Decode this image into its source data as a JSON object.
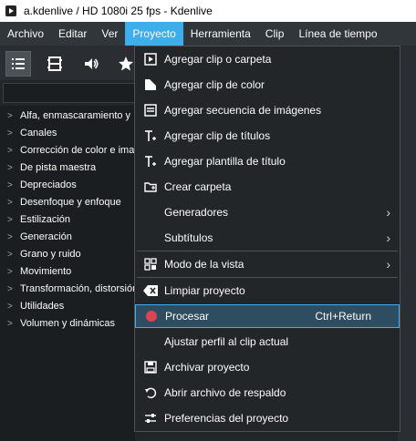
{
  "window": {
    "title": "a.kdenlive / HD 1080i 25 fps - Kdenlive"
  },
  "menubar": [
    {
      "label": "Archivo"
    },
    {
      "label": "Editar"
    },
    {
      "label": "Ver"
    },
    {
      "label": "Proyecto"
    },
    {
      "label": "Herramienta"
    },
    {
      "label": "Clip"
    },
    {
      "label": "Línea de tiempo"
    }
  ],
  "effects_tree": [
    "Alfa, enmascaramiento y",
    "Canales",
    "Corrección de color e imag",
    "De pista maestra",
    "Depreciados",
    "Desenfoque y enfoque",
    "Estilización",
    "Generación",
    "Grano y ruido",
    "Movimiento",
    "Transformación, distorsión",
    "Utilidades",
    "Volumen y dinámicas"
  ],
  "project_menu": {
    "items": [
      {
        "label": "Agregar clip o carpeta",
        "icon": "add-clip-icon"
      },
      {
        "label": "Agregar clip de color",
        "icon": "color-clip-icon"
      },
      {
        "label": "Agregar secuencia de imágenes",
        "icon": "image-sequence-icon"
      },
      {
        "label": "Agregar clip de títulos",
        "icon": "title-clip-icon"
      },
      {
        "label": "Agregar plantilla de título",
        "icon": "title-template-icon"
      },
      {
        "label": "Crear carpeta",
        "icon": "folder-icon"
      },
      {
        "label": "Generadores",
        "icon": ""
      },
      {
        "label": "Subtítulos",
        "icon": ""
      },
      {
        "label": "Modo de la vista",
        "icon": "view-mode-icon"
      },
      {
        "label": "Limpiar proyecto",
        "icon": "clear-icon"
      },
      {
        "label": "Procesar",
        "icon": "render-icon",
        "shortcut": "Ctrl+Return"
      },
      {
        "label": "Ajustar perfil al clip actual",
        "icon": ""
      },
      {
        "label": "Archivar proyecto",
        "icon": "archive-icon"
      },
      {
        "label": "Abrir archivo de respaldo",
        "icon": "backup-icon"
      },
      {
        "label": "Preferencias del proyecto",
        "icon": "settings-icon"
      }
    ]
  },
  "colors": {
    "accent": "#3daee9",
    "render_dot": "#da4453"
  }
}
